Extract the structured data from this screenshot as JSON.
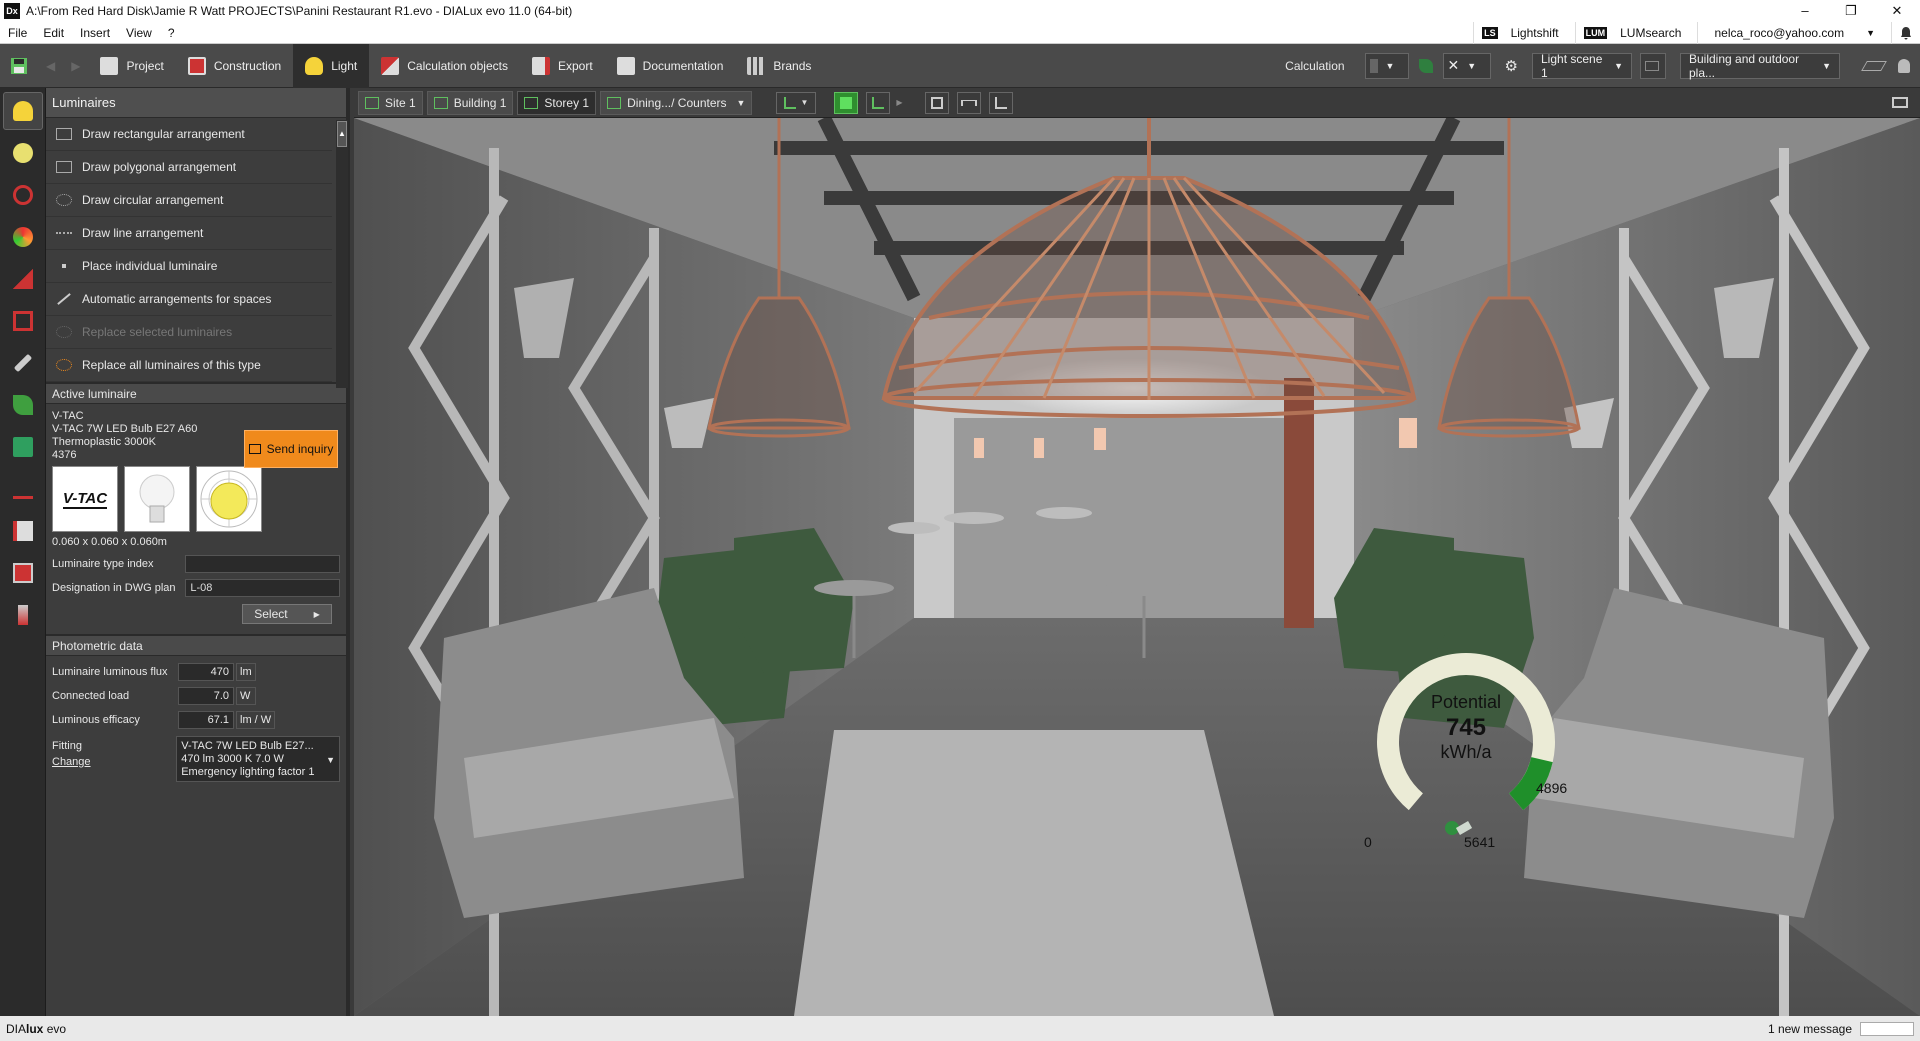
{
  "window": {
    "title": "A:\\From Red Hard Disk\\Jamie R Watt PROJECTS\\Panini Restaurant R1.evo - DIALux evo 11.0  (64-bit)",
    "app_icon": "Dx",
    "min": "–",
    "max": "❐",
    "close": "✕"
  },
  "menu": {
    "items": [
      "File",
      "Edit",
      "Insert",
      "View",
      "?"
    ],
    "lightshift_badge": "LS",
    "lightshift": "Lightshift",
    "lumsearch_badge": "LUM",
    "lumsearch": "LUMsearch",
    "user": "nelca_roco@yahoo.com"
  },
  "toolbar": {
    "tabs": [
      "Project",
      "Construction",
      "Light",
      "Calculation objects",
      "Export",
      "Documentation",
      "Brands"
    ],
    "active_tab": "Light",
    "calculation_label": "Calculation",
    "light_scene": "Light scene 1",
    "building_mode": "Building and outdoor pla..."
  },
  "panel": {
    "header": "Luminaires",
    "items": [
      {
        "label": "Draw rectangular arrangement",
        "enabled": true
      },
      {
        "label": "Draw polygonal arrangement",
        "enabled": true
      },
      {
        "label": "Draw circular arrangement",
        "enabled": true
      },
      {
        "label": "Draw line arrangement",
        "enabled": true
      },
      {
        "label": "Place individual luminaire",
        "enabled": true
      },
      {
        "label": "Automatic arrangements for spaces",
        "enabled": true
      },
      {
        "label": "Replace selected luminaires",
        "enabled": false
      },
      {
        "label": "Replace all luminaires of this type",
        "enabled": true
      }
    ],
    "active_luminaire": {
      "header": "Active luminaire",
      "manufacturer": "V-TAC",
      "name": "V-TAC 7W LED Bulb E27 A60",
      "variant": "Thermoplastic 3000K",
      "number": "4376",
      "send_inquiry": "Send inquiry",
      "logo_text": "V-TAC",
      "dimensions": "0.060 x 0.060 x 0.060m",
      "type_index_label": "Luminaire type index",
      "type_index_value": "",
      "dwg_label": "Designation in DWG plan",
      "dwg_value": "L-08",
      "select_label": "Select"
    },
    "photometric": {
      "header": "Photometric data",
      "flux_label": "Luminaire luminous flux",
      "flux_value": "470",
      "flux_unit": "lm",
      "load_label": "Connected load",
      "load_value": "7.0",
      "load_unit": "W",
      "efficacy_label": "Luminous efficacy",
      "efficacy_value": "67.1",
      "efficacy_unit": "lm / W",
      "fitting_label": "Fitting",
      "change_label": "Change",
      "fitting_line1": "V-TAC 7W LED Bulb E27...",
      "fitting_line2": "470 lm    3000 K    7.0 W",
      "fitting_line3": "Emergency lighting factor 1"
    }
  },
  "viewbar": {
    "crumbs": [
      "Site 1",
      "Building 1",
      "Storey 1",
      "Dining.../ Counters"
    ]
  },
  "gauge": {
    "title": "Potential",
    "value": "745",
    "unit": "kWh/a",
    "min": "0",
    "max": "5641",
    "marker": "4896",
    "fraction": 0.868,
    "track_color": "#ebebd6",
    "fill_color": "#1f8f2a"
  },
  "status": {
    "brand_a": "DIA",
    "brand_b": "lux",
    "brand_c": " evo",
    "message": "1 new message"
  },
  "colors": {
    "accent_orange": "#f08a1c",
    "accent_green": "#5fbf5f",
    "copper": "#b27256"
  }
}
